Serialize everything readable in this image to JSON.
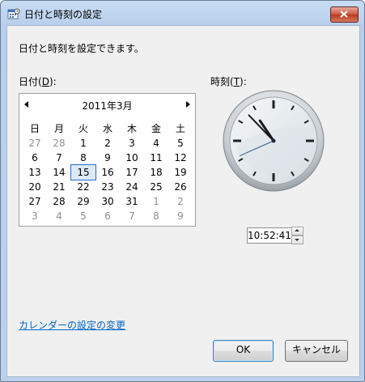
{
  "window": {
    "title": "日付と時刻の設定"
  },
  "instruction": "日付と時刻を設定できます。",
  "date_label": {
    "prefix": "日付(",
    "key": "D",
    "suffix": "):"
  },
  "time_label": {
    "prefix": "時刻(",
    "key": "T",
    "suffix": "):"
  },
  "calendar": {
    "month_title": "2011年3月",
    "weekdays": [
      "日",
      "月",
      "火",
      "水",
      "木",
      "金",
      "土"
    ],
    "weeks": [
      [
        {
          "d": "27",
          "o": true
        },
        {
          "d": "28",
          "o": true
        },
        {
          "d": "1"
        },
        {
          "d": "2"
        },
        {
          "d": "3"
        },
        {
          "d": "4"
        },
        {
          "d": "5"
        }
      ],
      [
        {
          "d": "6"
        },
        {
          "d": "7"
        },
        {
          "d": "8"
        },
        {
          "d": "9"
        },
        {
          "d": "10"
        },
        {
          "d": "11"
        },
        {
          "d": "12"
        }
      ],
      [
        {
          "d": "13"
        },
        {
          "d": "14"
        },
        {
          "d": "15",
          "sel": true
        },
        {
          "d": "16"
        },
        {
          "d": "17"
        },
        {
          "d": "18"
        },
        {
          "d": "19"
        }
      ],
      [
        {
          "d": "20"
        },
        {
          "d": "21"
        },
        {
          "d": "22"
        },
        {
          "d": "23"
        },
        {
          "d": "24"
        },
        {
          "d": "25"
        },
        {
          "d": "26"
        }
      ],
      [
        {
          "d": "27"
        },
        {
          "d": "28"
        },
        {
          "d": "29"
        },
        {
          "d": "30"
        },
        {
          "d": "31"
        },
        {
          "d": "1",
          "o": true
        },
        {
          "d": "2",
          "o": true
        }
      ],
      [
        {
          "d": "3",
          "o": true
        },
        {
          "d": "4",
          "o": true
        },
        {
          "d": "5",
          "o": true
        },
        {
          "d": "6",
          "o": true
        },
        {
          "d": "7",
          "o": true
        },
        {
          "d": "8",
          "o": true
        },
        {
          "d": "9",
          "o": true
        }
      ]
    ]
  },
  "clock": {
    "hour": 10,
    "minute": 52,
    "second": 41
  },
  "time_value": "10:52:41",
  "calendar_settings_link": "カレンダーの設定の変更",
  "buttons": {
    "ok": "OK",
    "cancel": "キャンセル"
  },
  "icons": {
    "title": "calendar-clock-icon",
    "close": "close-icon"
  }
}
